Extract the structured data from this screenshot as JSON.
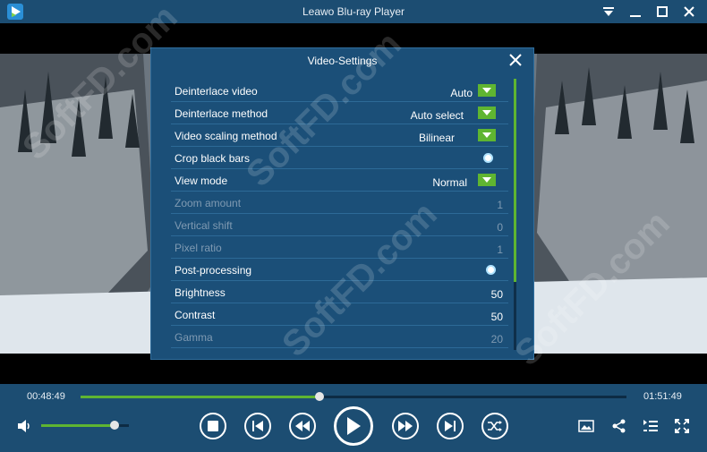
{
  "window": {
    "title": "Leawo Blu-ray Player"
  },
  "dialog": {
    "title": "Video-Settings",
    "rows": [
      {
        "label": "Deinterlace video",
        "value": "Auto",
        "control": "dropdown",
        "enabled": true
      },
      {
        "label": "Deinterlace method",
        "value": "Auto select",
        "control": "dropdown",
        "enabled": true
      },
      {
        "label": "Video scaling method",
        "value": "Bilinear",
        "control": "dropdown",
        "enabled": true
      },
      {
        "label": "Crop black bars",
        "value": "",
        "control": "toggle",
        "enabled": true
      },
      {
        "label": "View mode",
        "value": "Normal",
        "control": "dropdown",
        "enabled": true
      },
      {
        "label": "Zoom amount",
        "value": "1",
        "control": "number",
        "enabled": false
      },
      {
        "label": "Vertical shift",
        "value": "0",
        "control": "number",
        "enabled": false
      },
      {
        "label": "Pixel ratio",
        "value": "1",
        "control": "number",
        "enabled": false
      },
      {
        "label": "Post-processing",
        "value": "",
        "control": "toggle",
        "enabled": true
      },
      {
        "label": "Brightness",
        "value": "50",
        "control": "number",
        "enabled": true
      },
      {
        "label": "Contrast",
        "value": "50",
        "control": "number",
        "enabled": true
      },
      {
        "label": "Gamma",
        "value": "20",
        "control": "number",
        "enabled": false
      }
    ]
  },
  "playback": {
    "elapsed": "00:48:49",
    "duration": "01:51:49",
    "progress_fraction": 0.437,
    "volume_fraction": 0.84
  },
  "watermark": {
    "text": "SoftFD.com"
  },
  "colors": {
    "titlebar": "#1c4d72",
    "dialog_bg": "#1b4f78",
    "accent_green": "#5fb531"
  }
}
